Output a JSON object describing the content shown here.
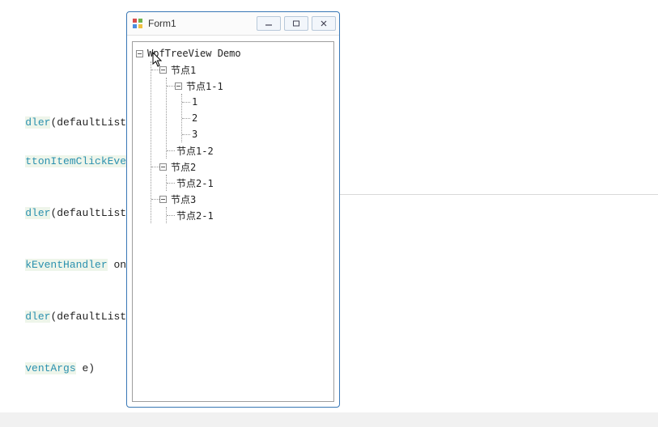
{
  "window": {
    "title": "Form1"
  },
  "tree": {
    "root_label": "WpfTreeView Demo",
    "n1_label": "节点1",
    "n1_1_label": "节点1-1",
    "n1_1_1_label": "1",
    "n1_1_2_label": "2",
    "n1_1_3_label": "3",
    "n1_2_label": "节点1-2",
    "n2_label": "节点2",
    "n2_1_label": "节点2-1",
    "n3_label": "节点3",
    "n3_1_label": "节点2-1"
  },
  "code": {
    "line1_a": "dler",
    "line1_b": "(defaultListener);",
    "line2_a": "ttonItemClickEventHand",
    "line3_a": "dler",
    "line3_b": "(defaultListener);",
    "line4_a": "kEventHandler",
    "line4_b": " onClick)",
    "line5_a": "dler",
    "line5_b": "(defaultListener);",
    "line6_a": "ventArgs",
    "line6_b": " e)"
  }
}
